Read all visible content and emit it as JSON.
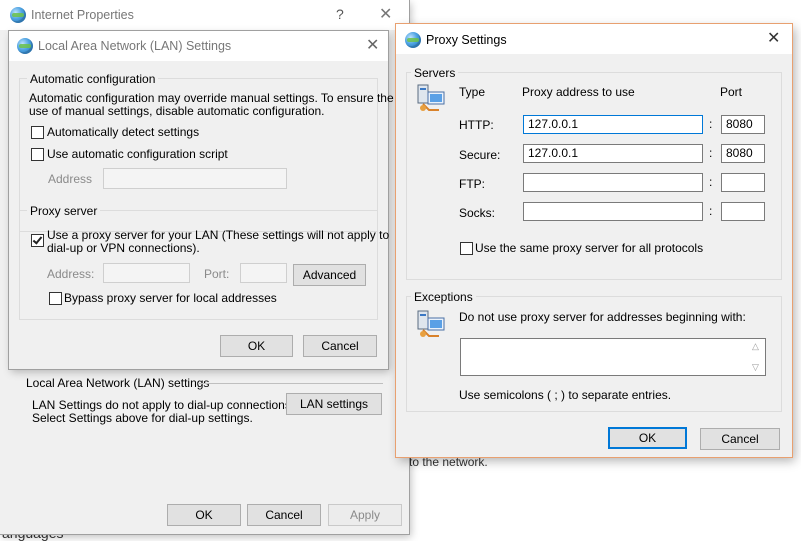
{
  "internet_properties": {
    "title": "Internet Properties",
    "help_label": "?",
    "close_label": "✕",
    "lan_section_label": "Local Area Network (LAN) settings",
    "lan_note_line1": "LAN Settings do not apply to dial-up connections.",
    "lan_note_line2": "Select Settings above for dial-up settings.",
    "lan_settings_button": "LAN settings",
    "ok": "OK",
    "cancel": "Cancel",
    "apply": "Apply"
  },
  "background": {
    "network_fragment": "to the network.",
    "languages_fragment": "anguages"
  },
  "lan_dialog": {
    "title": "Local Area Network (LAN) Settings",
    "close_label": "✕",
    "auto_config_label": "Automatic configuration",
    "auto_config_desc_line1": "Automatic configuration may override manual settings.  To ensure the",
    "auto_config_desc_line2": "use of manual settings, disable automatic configuration.",
    "auto_detect_label": "Automatically detect settings",
    "auto_detect_checked": false,
    "auto_script_label": "Use automatic configuration script",
    "auto_script_checked": false,
    "address_label": "Address",
    "address_value": "",
    "proxy_server_label": "Proxy server",
    "use_proxy_line1": "Use a proxy server for your LAN (These settings will not apply to",
    "use_proxy_line2": "dial-up or VPN connections).",
    "use_proxy_checked": true,
    "proxy_address_label": "Address:",
    "proxy_address_value": "",
    "proxy_port_label": "Port:",
    "proxy_port_value": "",
    "advanced_button": "Advanced",
    "bypass_label": "Bypass proxy server for local addresses",
    "bypass_checked": false,
    "ok": "OK",
    "cancel": "Cancel"
  },
  "proxy_dialog": {
    "title": "Proxy Settings",
    "close_label": "✕",
    "servers_label": "Servers",
    "col_type": "Type",
    "col_address": "Proxy address to use",
    "col_port": "Port",
    "rows": [
      {
        "type": "HTTP:",
        "address": "127.0.0.1",
        "port": "8080"
      },
      {
        "type": "Secure:",
        "address": "127.0.0.1",
        "port": "8080"
      },
      {
        "type": "FTP:",
        "address": "",
        "port": ""
      },
      {
        "type": "Socks:",
        "address": "",
        "port": ""
      }
    ],
    "colon": ":",
    "same_proxy_label": "Use the same proxy server for all protocols",
    "same_proxy_checked": false,
    "exceptions_label": "Exceptions",
    "exceptions_desc": "Do not use proxy server for addresses beginning with:",
    "exceptions_value": "",
    "semicolons_note": "Use semicolons ( ; ) to separate entries.",
    "ok": "OK",
    "cancel": "Cancel"
  },
  "colors": {
    "accent": "#0078d7",
    "dialog_bg": "#f0f0f0",
    "disabled_text": "#8a8a8a"
  }
}
